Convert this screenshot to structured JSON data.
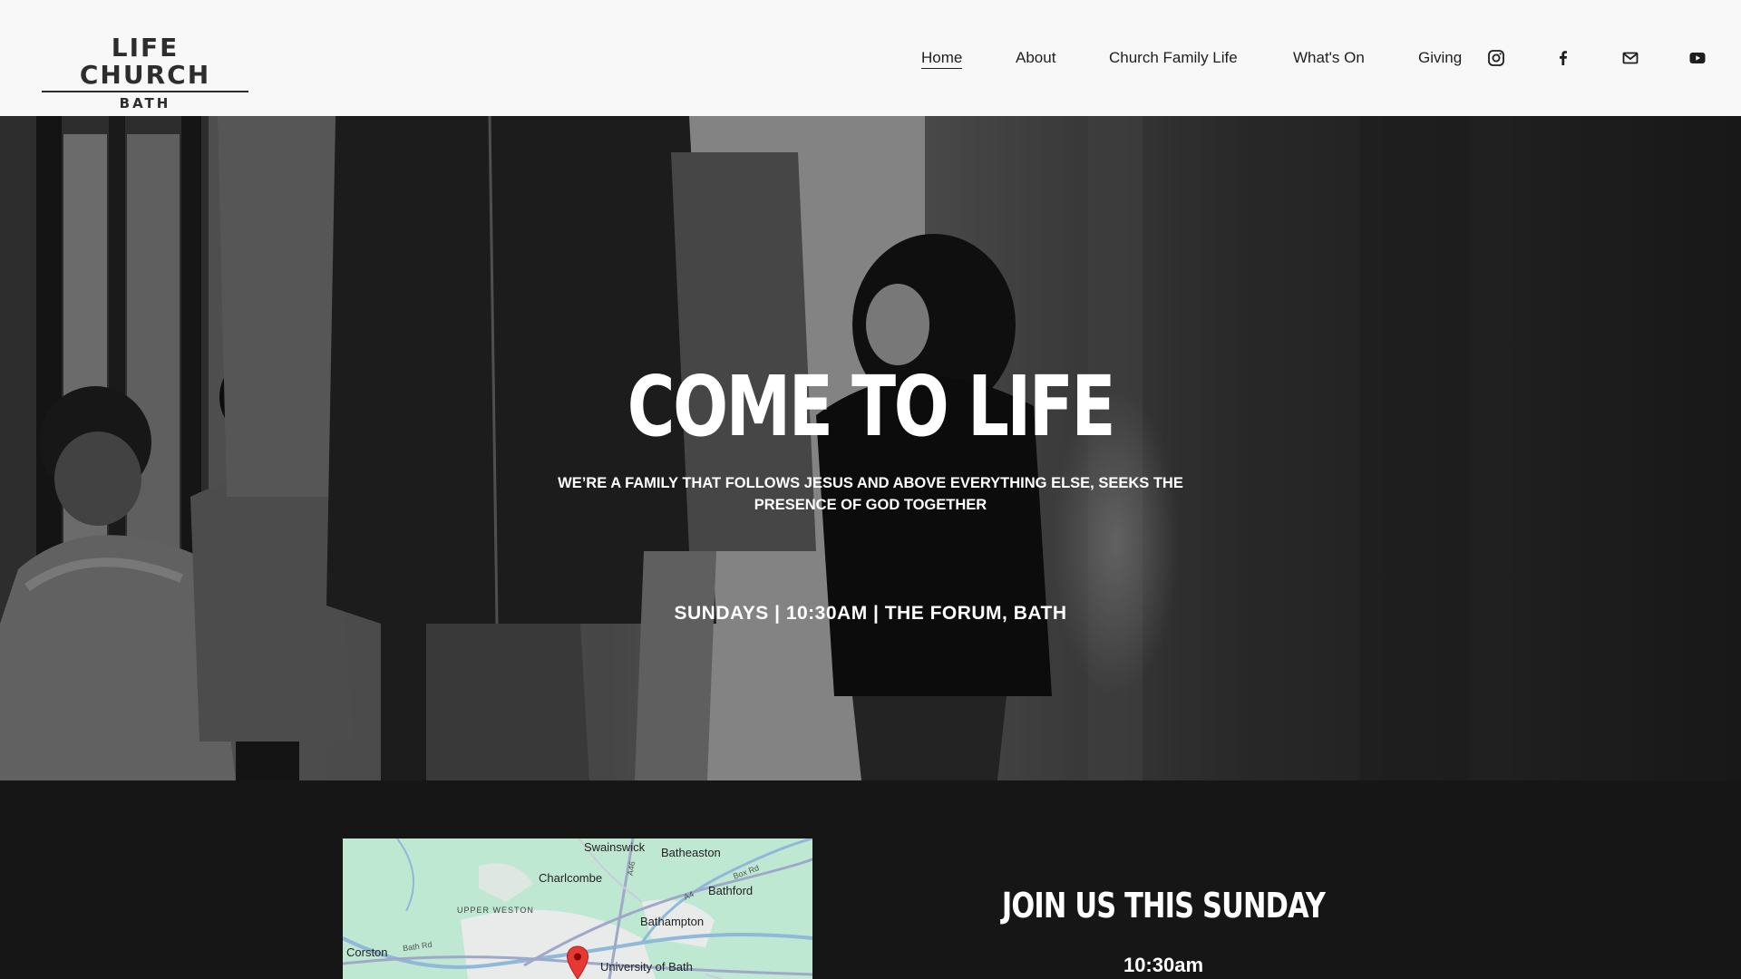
{
  "header": {
    "logo": {
      "line1": "LIFE CHURCH",
      "line2": "BATH"
    },
    "nav": [
      {
        "label": "Home",
        "active": true
      },
      {
        "label": "About"
      },
      {
        "label": "Church Family Life"
      },
      {
        "label": "What's On"
      },
      {
        "label": "Giving"
      }
    ],
    "social_icons": [
      "instagram-icon",
      "facebook-icon",
      "mail-icon",
      "youtube-icon"
    ]
  },
  "hero": {
    "title": "COME TO LIFE",
    "subtitle": "WE’RE A FAMILY THAT FOLLOWS JESUS AND ABOVE EVERYTHING ELSE, SEEKS THE PRESENCE OF GOD TOGETHER",
    "service_times": "SUNDAYS | 10:30AM | THE FORUM, BATH"
  },
  "map": {
    "places": [
      "Swainswick",
      "Batheaston",
      "Charlcombe",
      "Bathford",
      "UPPER WESTON",
      "Bathampton",
      "Corston",
      "University of Bath"
    ],
    "roads": [
      "A46",
      "Box Rd",
      "A4",
      "Bath Rd"
    ]
  },
  "join": {
    "title": "JOIN US THIS SUNDAY",
    "time": "10:30am"
  },
  "colors": {
    "header_bg": "#f8f8f8",
    "text_dark": "#1e1e1e",
    "lower_bg": "#161616",
    "map_green": "#bfe8d3",
    "pin_red": "#e53935"
  }
}
